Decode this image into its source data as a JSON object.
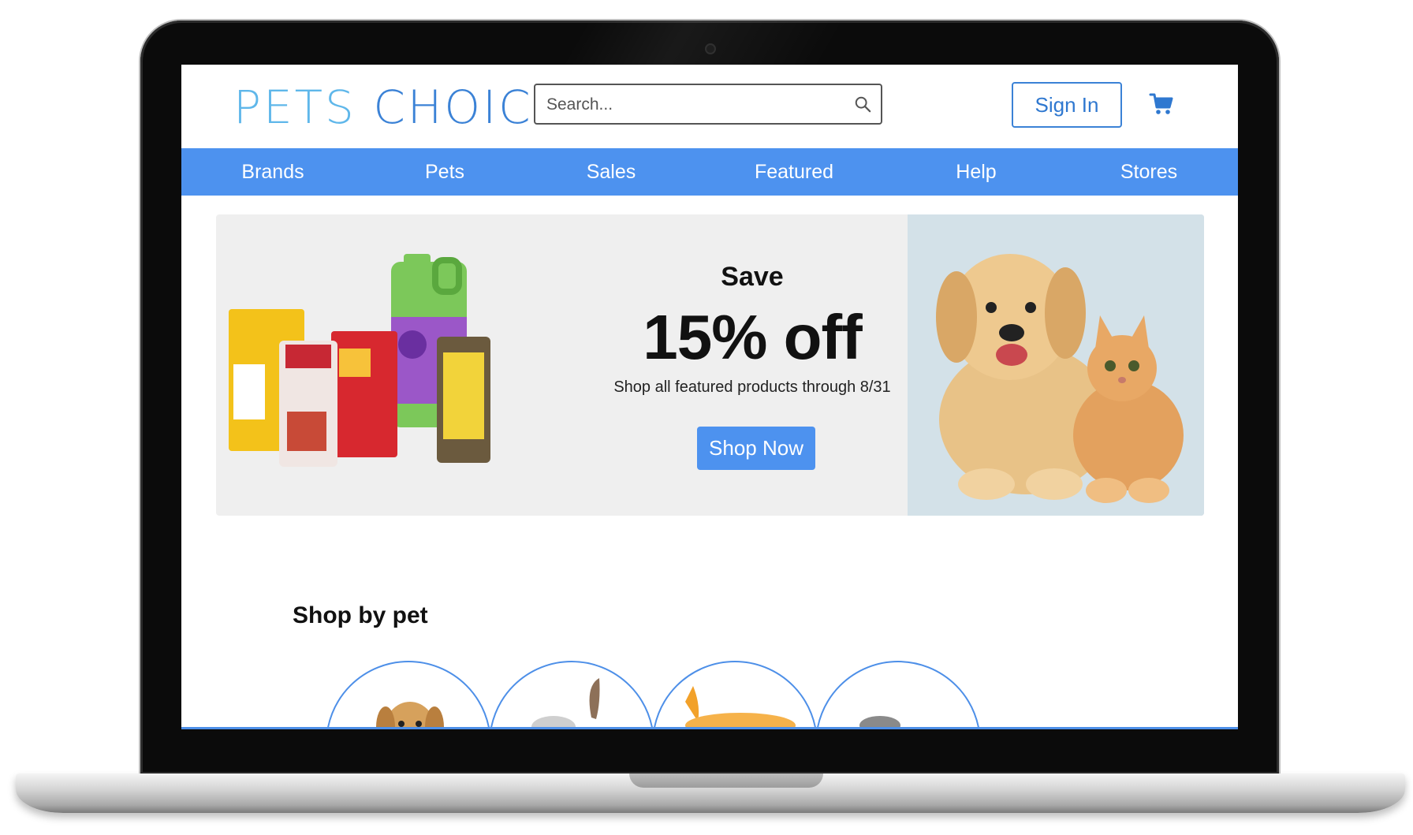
{
  "brand": {
    "logo_part1": "PETS ",
    "logo_part2": "CHOICE"
  },
  "header": {
    "search": {
      "placeholder": "Search...",
      "value": ""
    },
    "sign_in_label": "Sign In"
  },
  "nav": {
    "items": [
      {
        "label": "Brands"
      },
      {
        "label": "Pets"
      },
      {
        "label": "Sales"
      },
      {
        "label": "Featured"
      },
      {
        "label": "Help"
      },
      {
        "label": "Stores"
      }
    ]
  },
  "promo": {
    "save": "Save",
    "discount": "15% off",
    "subtitle": "Shop all featured products through 8/31",
    "cta_label": "Shop Now"
  },
  "shop_by_pet": {
    "title": "Shop by pet"
  },
  "colors": {
    "accent": "#4d92ef",
    "logo_light": "#5fb7ea",
    "logo_dark": "#3b82d6",
    "banner_bg": "#efefef"
  }
}
